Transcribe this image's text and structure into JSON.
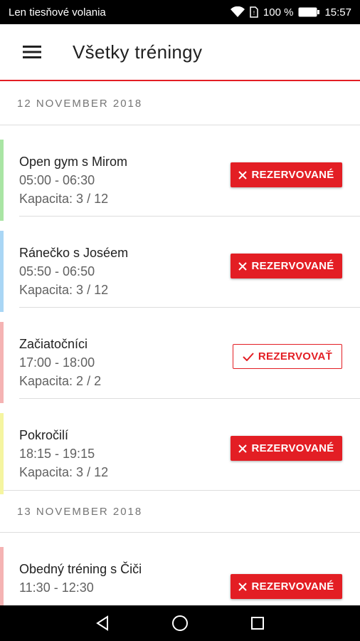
{
  "status_bar": {
    "carrier": "Len tiesňové volania",
    "battery": "100 %",
    "time": "15:57"
  },
  "app_bar": {
    "title": "Všetky tréningy",
    "menu_icon": "hamburger-menu-icon"
  },
  "colors": {
    "accent": "#e31e24",
    "green": "#a9e5a4",
    "blue": "#a9d6f5",
    "pink": "#f5b3b3",
    "yellow": "#f5f5a0"
  },
  "sections": [
    {
      "date": "12 NOVEMBER 2018",
      "items": [
        {
          "name": "Open gym s Mirom",
          "time": "05:00 - 06:30",
          "capacity": "Kapacita: 3 / 12",
          "button": "REZERVOVANÉ",
          "button_state": "reserved",
          "color": "green"
        },
        {
          "name": "Ránečko s Joséem",
          "time": "05:50 - 06:50",
          "capacity": "Kapacita: 3 / 12",
          "button": "REZERVOVANÉ",
          "button_state": "reserved",
          "color": "blue"
        },
        {
          "name": "Začiatočníci",
          "time": "17:00 - 18:00",
          "capacity": "Kapacita: 2 / 2",
          "button": "REZERVOVAŤ",
          "button_state": "available",
          "color": "pink"
        },
        {
          "name": "Pokročilí",
          "time": "18:15 - 19:15",
          "capacity": "Kapacita: 3 / 12",
          "button": "REZERVOVANÉ",
          "button_state": "reserved",
          "color": "yellow"
        }
      ]
    },
    {
      "date": "13 NOVEMBER 2018",
      "items": [
        {
          "name": "Obedný tréning s Čiči",
          "time": "11:30 - 12:30",
          "capacity": "",
          "button": "REZERVOVANÉ",
          "button_state": "reserved",
          "color": "pink"
        }
      ]
    }
  ],
  "nav_bar": {
    "back_icon": "back-triangle-icon",
    "home_icon": "home-circle-icon",
    "recents_icon": "recents-square-icon"
  }
}
